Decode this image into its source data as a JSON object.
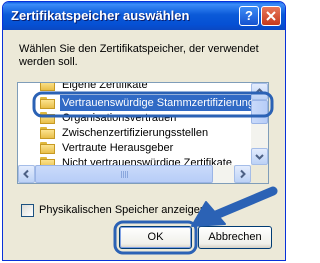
{
  "window": {
    "title": "Zertifikatspeicher auswählen",
    "help_label": "?"
  },
  "description": "Wählen Sie den Zertifikatspeicher, der verwendet werden soll.",
  "list": {
    "items": [
      {
        "label": "Eigene Zertifikate",
        "selected": false
      },
      {
        "label": "Vertrauenswürdige Stammzertifizierungs",
        "selected": true
      },
      {
        "label": "Organisationsvertrauen",
        "selected": false
      },
      {
        "label": "Zwischenzertifizierungsstellen",
        "selected": false
      },
      {
        "label": "Vertraute Herausgeber",
        "selected": false
      },
      {
        "label": "Nicht vertrauenswürdige Zertifikate",
        "selected": false
      }
    ]
  },
  "checkbox": {
    "label": "Physikalischen Speicher anzeigen",
    "checked": false
  },
  "buttons": {
    "ok": "OK",
    "cancel": "Abbrechen"
  },
  "colors": {
    "title_bar": "#0550d4",
    "selection": "#316ac5",
    "annotation": "#2b62b5"
  },
  "annotations": {
    "arrow_icon": "pointer-arrow-icon",
    "highlight_target": "Vertrauenswürdige Stammzertifizierungs"
  }
}
